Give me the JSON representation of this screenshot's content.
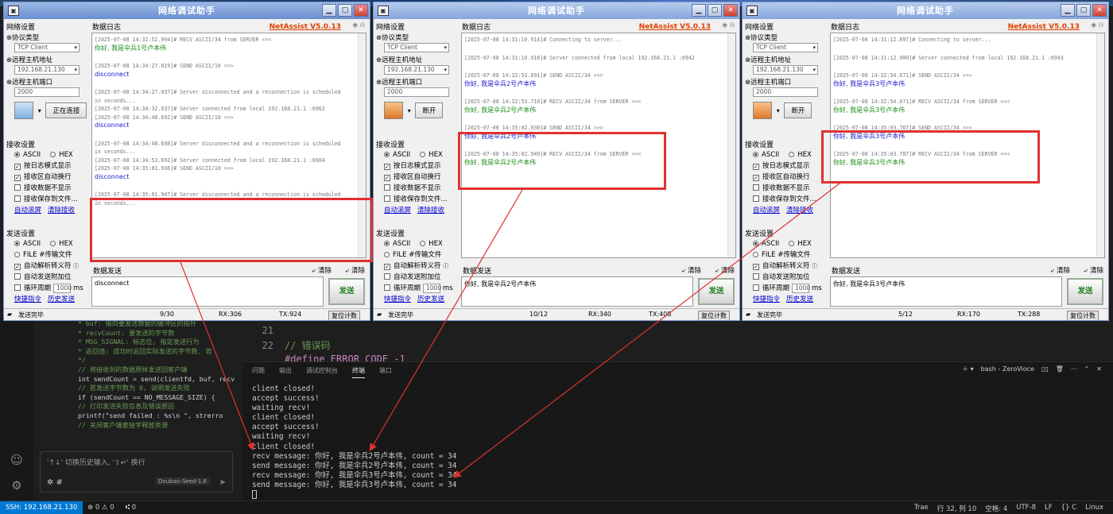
{
  "ide": {
    "code_left": [
      "* buf: 指向要发送数据的缓冲区的指针",
      "* recvCount: 要发送的字节数",
      "* MSG_SIGNAL: 标志位, 指定发送行为",
      "* 返回值: 成功时返回实际发送的字节数, 若",
      "*/",
      "// 将接收到的数据原样发送回客户端",
      "int sendCount = send(clientfd, buf, recv",
      "// 若发送字节数为 0, 说明发送失败",
      "if (sendCount == NO_MESSAGE_SIZE) {",
      "    // 打印发送失败信息及错误原因",
      "    printf(\"send failed : %s\\n \", strerro",
      "    // 关闭客户端套接字释放资源"
    ],
    "code_right": {
      "line21": "21",
      "line22": "22",
      "comment": "// 错误码",
      "define": "#define ERROR_CODE -1"
    },
    "chat": {
      "placeholder": "'↑↓' 切换历史输入, '⇧↵' 换行",
      "model": "Doubao-Seed-1.6"
    },
    "panel_tabs": [
      "问题",
      "输出",
      "调试控制台",
      "终端",
      "端口"
    ],
    "active_tab": "终端",
    "terminal_name": "bash - ZeroVioce",
    "terminal_lines": [
      "client closed!",
      "accept success!",
      "waiting recv!",
      "client closed!",
      "accept success!",
      "waiting recv!",
      "client closed!",
      "recv message: 你好, 我是伞兵2号卢本伟, count = 34",
      "send message: 你好, 我是伞兵2号卢本伟, count = 34",
      "recv message: 你好, 我是伞兵3号卢本伟, count = 34",
      "send message: 你好, 我是伞兵3号卢本伟, count = 34"
    ],
    "status": {
      "ssh": "SSH: 192.168.21.130",
      "errors": "⊗ 0 ⚠ 0",
      "ports": "⑆ 0",
      "right": [
        "Trae",
        "行 32, 列 10",
        "空格: 4",
        "UTF-8",
        "LF",
        "{} C",
        "Linux"
      ]
    }
  },
  "common": {
    "title": "网络调试助手",
    "brand": "NetAssist V5.0.13",
    "net_settings": "网络设置",
    "protocol_label": "⊗协议类型",
    "protocol": "TCP Client",
    "host_label": "⊗远程主机地址",
    "host": "192.168.21.130",
    "port_label": "⊗远程主机端口",
    "port": "2000",
    "log_header": "数据日志",
    "recv_settings": "接收设置",
    "ascii": "ASCII",
    "hex": "HEX",
    "recv_opts": [
      "按日志模式显示",
      "接收区自动换行",
      "接收数据不显示",
      "接收保存到文件..."
    ],
    "auto_scroll": "自动滚屏",
    "clear_recv": "清除接收",
    "send_settings": "发送设置",
    "file": "FILE",
    "file_load": "#传输文件",
    "send_opts": [
      "自动解析转义符",
      "自动发送附加位",
      "循环周期"
    ],
    "period": "1000",
    "ms": "ms",
    "shortcut": "快捷指令",
    "history": "历史发送",
    "send_header": "数据发送",
    "clear": "清除",
    "clear2": "清除",
    "send_btn": "发送",
    "reset": "复位计数",
    "sent_done": "发送完毕"
  },
  "windows": [
    {
      "connect_btn": "正在连接",
      "send_text": "disconnect",
      "count": "9/30",
      "rx": "RX:306",
      "tx": "TX:924",
      "log": [
        {
          "t": "[2025-07-08 14:32:52.994]# RECV ASCII/34 from SERVER <<<",
          "c": ""
        },
        {
          "t": "你好, 我是伞兵1号卢本伟",
          "c": "g"
        },
        {
          "t": "[2025-07-08 14:34:27.019]# SEND ASCII/10 >>>",
          "c": ""
        },
        {
          "t": "disconnect",
          "c": "b"
        },
        {
          "t": "[2025-07-08 14:34:27.037]# Server disconnected and a reconnection is scheduled",
          "c": ""
        },
        {
          "t": "in seconds...",
          "c": ""
        },
        {
          "t": "[2025-07-08 14:34:32.037]# Server connected from local 192.168.21.1 :6962",
          "c": ""
        },
        {
          "t": "[2025-07-08 14:34:48.692]# SEND ASCII/10 >>>",
          "c": ""
        },
        {
          "t": "disconnect",
          "c": "b"
        },
        {
          "t": "[2025-07-08 14:34:48.698]# Server disconnected and a reconnection is scheduled",
          "c": ""
        },
        {
          "t": "in seconds...",
          "c": ""
        },
        {
          "t": "[2025-07-08 14:34:53.692]# Server connected from local 192.168.21.1 :6964",
          "c": ""
        },
        {
          "t": "[2025-07-08 14:35:01.936]# SEND ASCII/10 >>>",
          "c": ""
        },
        {
          "t": "disconnect",
          "c": "b"
        },
        {
          "t": "[2025-07-08 14:35:01.947]# Server disconnected and a reconnection is scheduled",
          "c": ""
        },
        {
          "t": "in seconds...",
          "c": ""
        }
      ]
    },
    {
      "connect_btn": "断开",
      "send_text": "你好, 我是伞兵2号卢本伟",
      "count": "10/12",
      "rx": "RX:340",
      "tx": "TX:408",
      "log": [
        {
          "t": "[2025-07-08 14:31:10.914]# Connecting to server...",
          "c": ""
        },
        {
          "t": "[2025-07-08 14:31:10.916]# Server connected from local 192.168.21.1 :6942",
          "c": ""
        },
        {
          "t": "[2025-07-08 14:32:53.691]# SEND ASCII/34 >>>",
          "c": ""
        },
        {
          "t": "你好, 我是伞兵2号卢本伟",
          "c": "b"
        },
        {
          "t": "[2025-07-08 14:32:53.710]# RECV ASCII/34 from SERVER <<<",
          "c": ""
        },
        {
          "t": "你好, 我是伞兵2号卢本伟",
          "c": "g"
        },
        {
          "t": "[2025-07-08 14:35:02.930]# SEND ASCII/34 >>>",
          "c": ""
        },
        {
          "t": "你好, 我是伞兵2号卢本伟",
          "c": "b"
        },
        {
          "t": "[2025-07-08 14:35:02.949]# RECV ASCII/34 from SERVER <<<",
          "c": ""
        },
        {
          "t": "你好, 我是伞兵2号卢本伟",
          "c": "g"
        }
      ]
    },
    {
      "connect_btn": "断开",
      "send_text": "你好, 我是伞兵3号卢本伟",
      "count": "5/12",
      "rx": "RX:170",
      "tx": "TX:288",
      "log": [
        {
          "t": "[2025-07-08 14:31:12.897]# Connecting to server...",
          "c": ""
        },
        {
          "t": "[2025-07-08 14:31:12.900]# Server connected from local 192.168.21.1 :6943",
          "c": ""
        },
        {
          "t": "[2025-07-08 14:32:54.671]# SEND ASCII/34 >>>",
          "c": ""
        },
        {
          "t": "你好, 我是伞兵3号卢本伟",
          "c": "b"
        },
        {
          "t": "[2025-07-08 14:32:54.671]# RECV ASCII/34 from SERVER <<<",
          "c": ""
        },
        {
          "t": "你好, 我是伞兵3号卢本伟",
          "c": "g"
        },
        {
          "t": "[2025-07-08 14:35:03.767]# SEND ASCII/34 >>>",
          "c": ""
        },
        {
          "t": "你好, 我是伞兵3号卢本伟",
          "c": "b"
        },
        {
          "t": "[2025-07-08 14:35:03.787]# RECV ASCII/34 from SERVER <<<",
          "c": ""
        },
        {
          "t": "你好, 我是伞兵3号卢本伟",
          "c": "g"
        }
      ]
    }
  ],
  "colors": {
    "annotation": "#e03030",
    "accent": "#0078d4",
    "brand": "#e04000"
  }
}
